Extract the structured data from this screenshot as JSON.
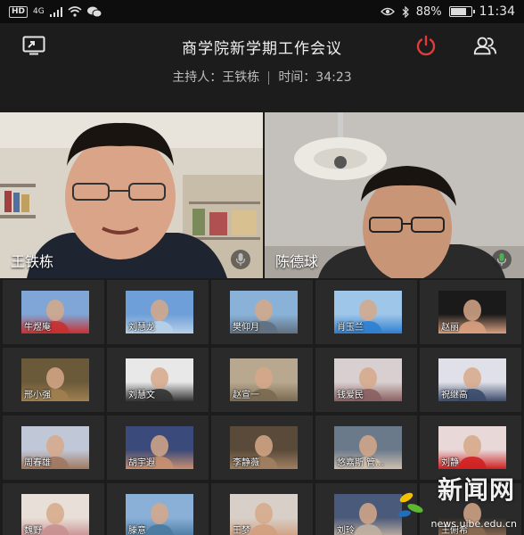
{
  "status_bar": {
    "hd_label": "HD",
    "signal_label": "4G",
    "battery_text": "88%",
    "battery_level": 0.88,
    "time": "11:34"
  },
  "header": {
    "title": "商学院新学期工作会议",
    "host_label": "主持人：王铁栋",
    "time_label": "时间：34:23",
    "colors": {
      "power": "#e23b3b"
    },
    "icons": [
      "screen-share-icon",
      "power-icon",
      "participants-icon"
    ]
  },
  "main_videos": [
    {
      "name": "王铁栋"
    },
    {
      "name": "陈德球"
    }
  ],
  "participants": [
    {
      "name": "牛煜庵"
    },
    {
      "name": "刘慧龙"
    },
    {
      "name": "樊仰月"
    },
    {
      "name": "肖玉兰"
    },
    {
      "name": "赵丽"
    },
    {
      "name": "邢小强"
    },
    {
      "name": "刘慧文"
    },
    {
      "name": "赵宣一"
    },
    {
      "name": "钱爱民"
    },
    {
      "name": "祝继高"
    },
    {
      "name": "周春雄"
    },
    {
      "name": "胡宇遐"
    },
    {
      "name": "李静薇"
    },
    {
      "name": "悠嘉斯 管..."
    },
    {
      "name": "刘静"
    },
    {
      "name": "魏野"
    },
    {
      "name": "滕意"
    },
    {
      "name": "王梦"
    },
    {
      "name": "刘玲"
    },
    {
      "name": "王俯希"
    }
  ],
  "watermark": {
    "text": "新闻网",
    "url": "news.uibe.edu.cn"
  }
}
